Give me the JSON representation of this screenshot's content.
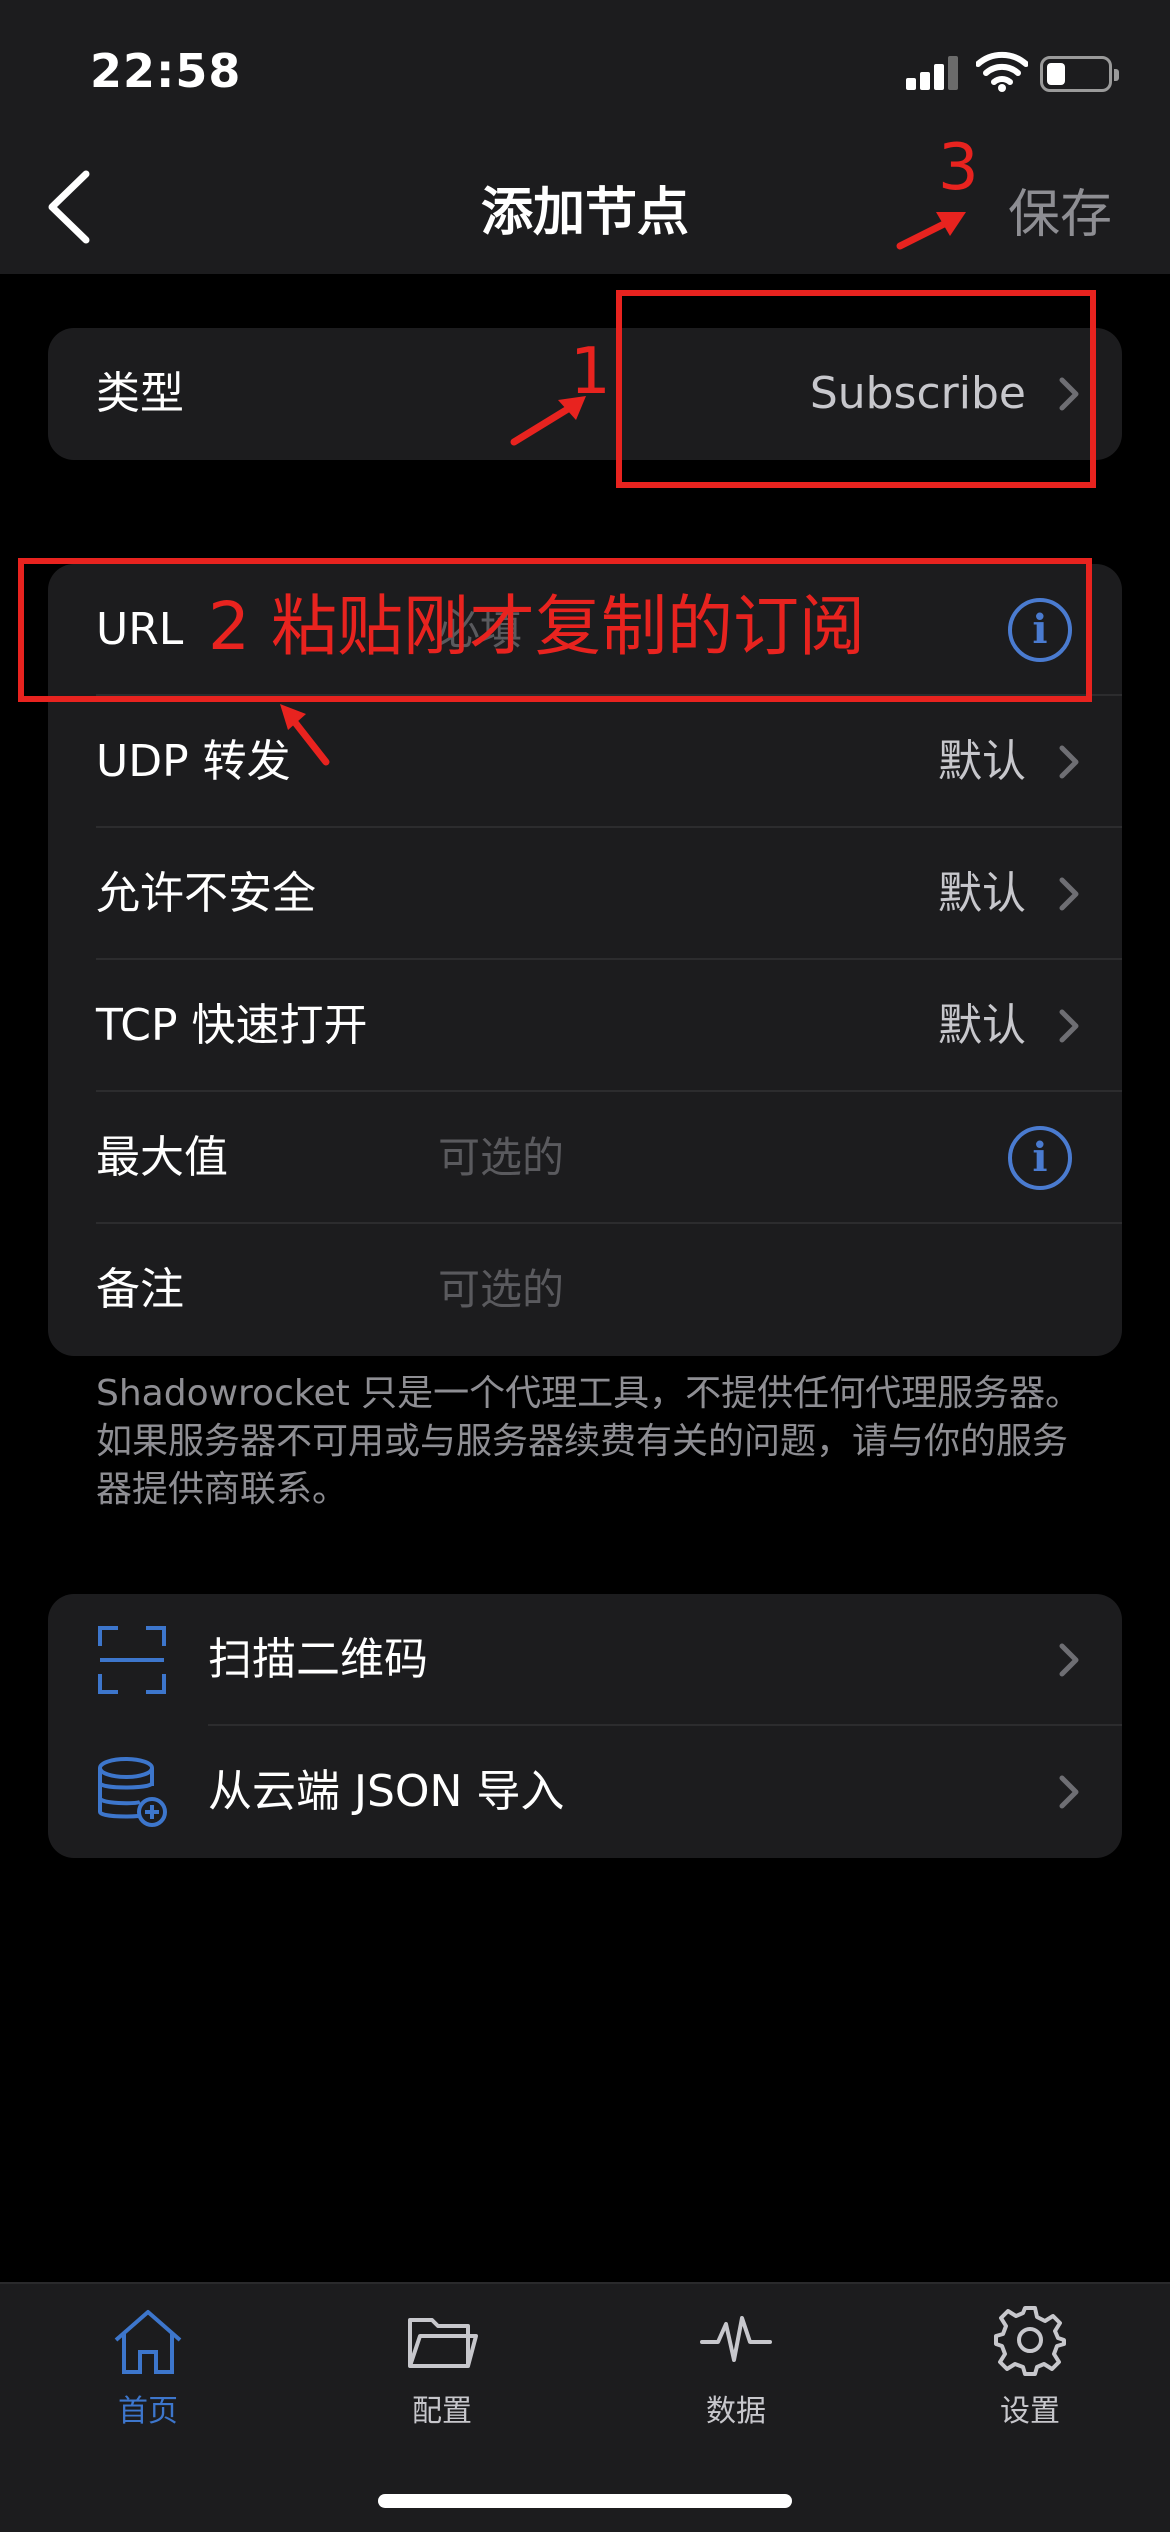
{
  "status_bar": {
    "time": "22:58"
  },
  "nav": {
    "title": "添加节点",
    "save_label": "保存"
  },
  "type_row": {
    "label": "类型",
    "value": "Subscribe"
  },
  "settings": {
    "url": {
      "label": "URL",
      "placeholder": "必填"
    },
    "udp": {
      "label": "UDP 转发",
      "value": "默认"
    },
    "insecure": {
      "label": "允许不安全",
      "value": "默认"
    },
    "tfo": {
      "label": "TCP 快速打开",
      "value": "默认"
    },
    "max": {
      "label": "最大值",
      "placeholder": "可选的"
    },
    "remark": {
      "label": "备注",
      "placeholder": "可选的"
    }
  },
  "footnote": "Shadowrocket 只是一个代理工具，不提供任何代理服务器。如果服务器不可用或与服务器续费有关的问题，请与你的服务器提供商联系。",
  "actions": [
    {
      "label": "扫描二维码",
      "icon": "scan-icon"
    },
    {
      "label": "从云端 JSON 导入",
      "icon": "database-add-icon"
    }
  ],
  "tabs": [
    {
      "label": "首页",
      "icon": "home-icon",
      "active": true
    },
    {
      "label": "配置",
      "icon": "folder-icon",
      "active": false
    },
    {
      "label": "数据",
      "icon": "pulse-icon",
      "active": false
    },
    {
      "label": "设置",
      "icon": "gear-icon",
      "active": false
    }
  ],
  "annotations": {
    "step1": "1",
    "step2": "2 粘贴刚才复制的订阅",
    "step3": "3"
  },
  "colors": {
    "annotation": "#e8231f",
    "accent": "#3d76cc",
    "background": "#000000",
    "card": "#1c1c1e"
  }
}
